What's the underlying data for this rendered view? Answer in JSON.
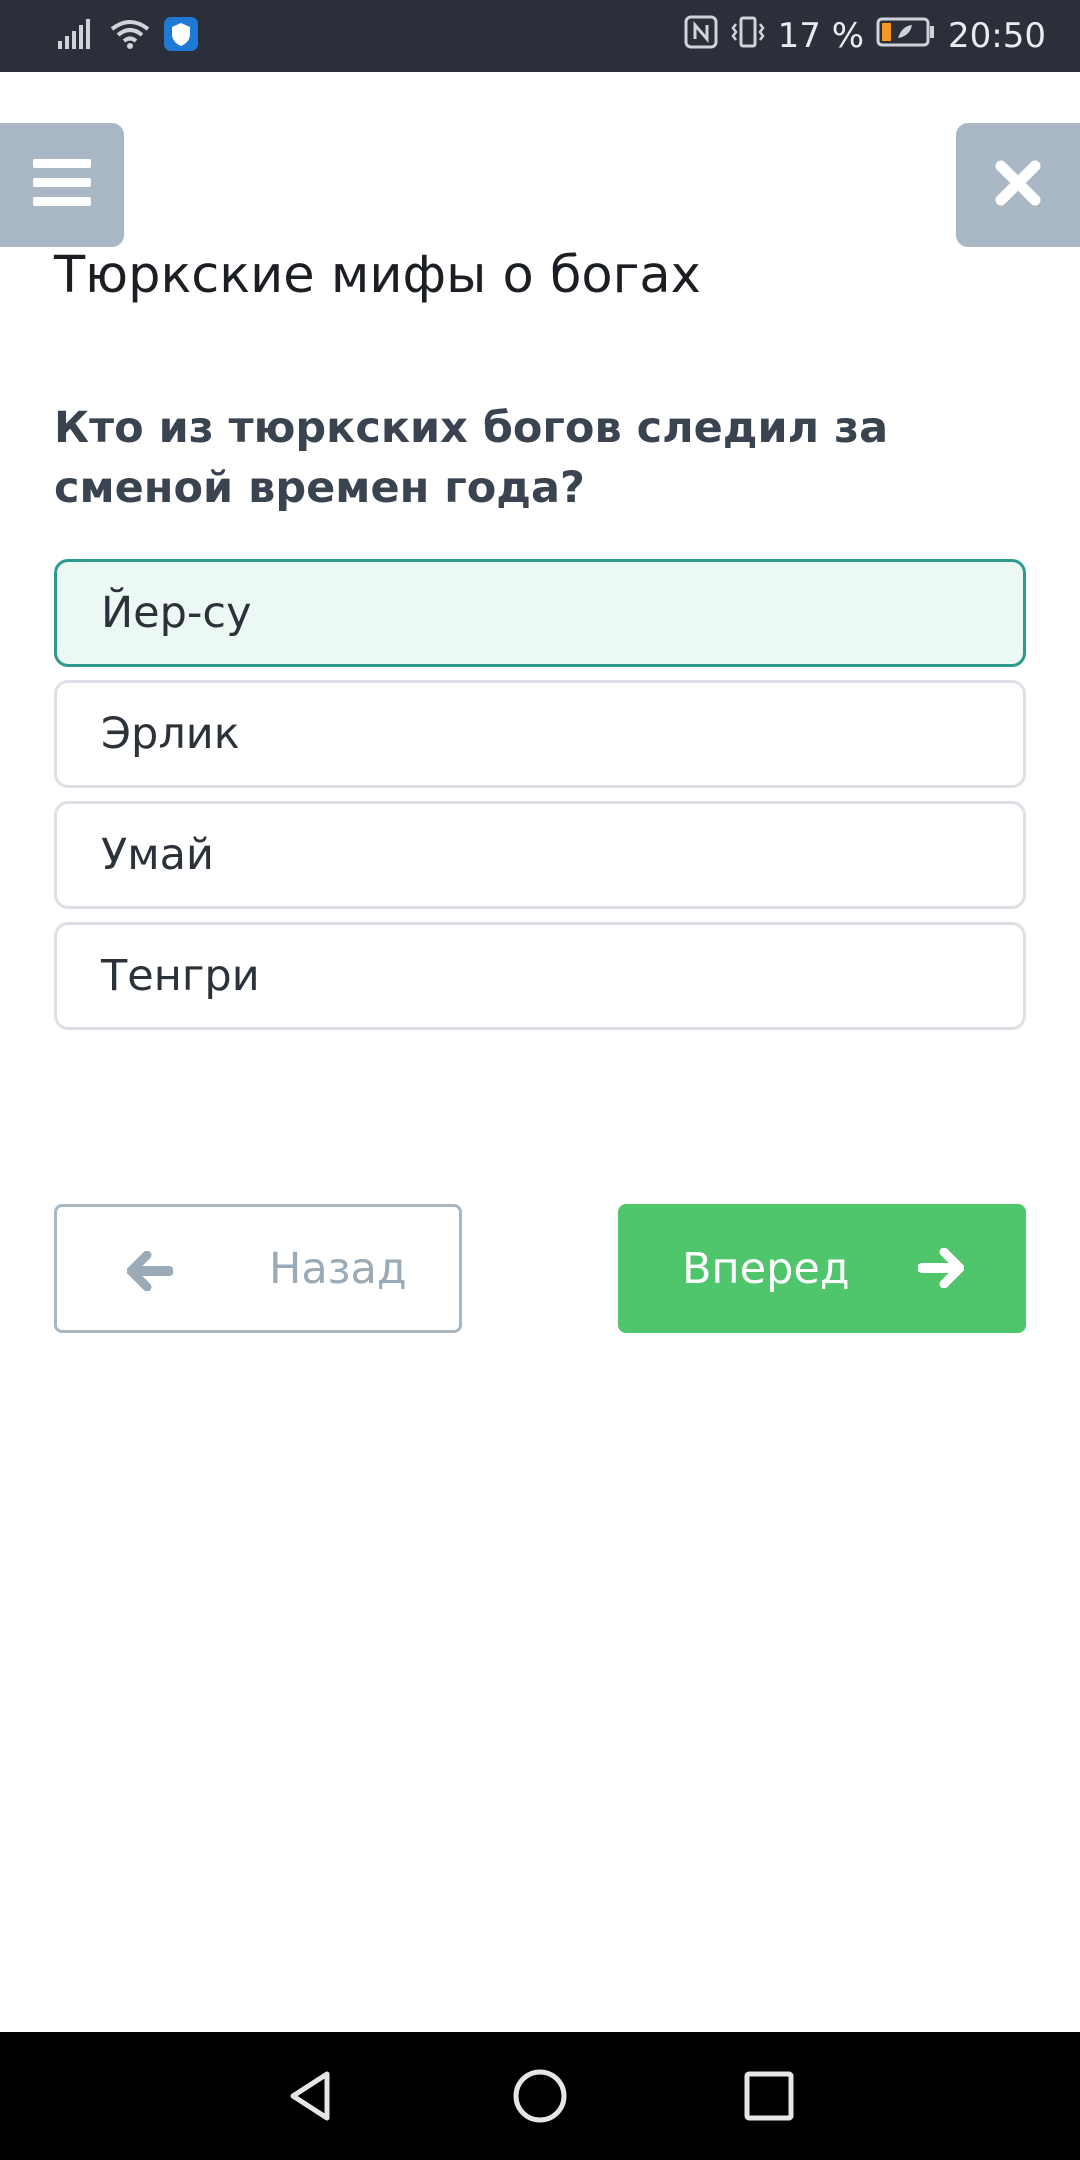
{
  "status_bar": {
    "battery_percent": "17 %",
    "time": "20:50",
    "icons": [
      "signal-icon",
      "wifi-icon",
      "shield-app-icon",
      "nfc-icon",
      "vibrate-icon",
      "battery-icon"
    ]
  },
  "header": {
    "menu_icon": "hamburger-icon",
    "close_icon": "close-icon",
    "title": "Тюркские мифы о богах"
  },
  "quiz": {
    "question": "Кто из тюркских богов следил за сменой времен года?",
    "options": [
      {
        "label": "Йер-су",
        "selected": true
      },
      {
        "label": "Эрлик",
        "selected": false
      },
      {
        "label": "Умай",
        "selected": false
      },
      {
        "label": "Тенгри",
        "selected": false
      }
    ],
    "back_label": "Назад",
    "forward_label": "Вперед"
  },
  "colors": {
    "status_bar_bg": "#2b2f3a",
    "header_buttons": "#a9b8c4",
    "selected_border": "#2d9a8c",
    "selected_bg": "#ebf8f4",
    "forward_button": "#4fc56c"
  },
  "system_nav": {
    "icons": [
      "back-triangle-icon",
      "home-circle-icon",
      "recents-square-icon"
    ]
  }
}
